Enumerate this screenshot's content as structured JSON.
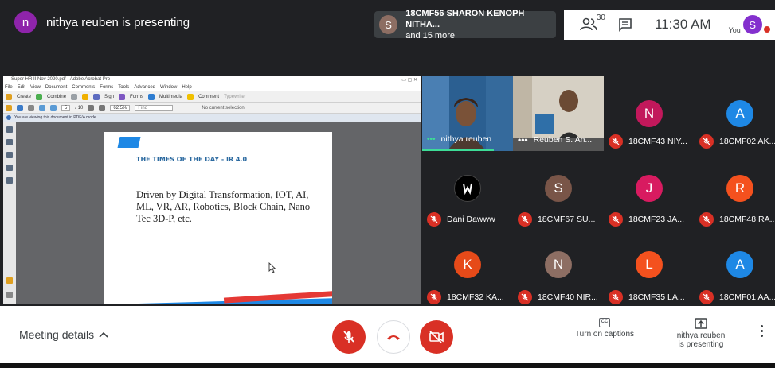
{
  "topbar": {
    "presenter_avatar": "n",
    "presenter_text": "nithya reuben is presenting",
    "participants_avatar": "S",
    "participants_name": "18CMF56 SHARON KENOPH NITHA...",
    "participants_more": "and 15 more",
    "people_icon": "people-icon",
    "people_count": "30",
    "chat_icon": "chat-icon",
    "time": "11:30 AM",
    "you_label": "You",
    "you_avatar": "S"
  },
  "acrobat": {
    "title": "Super HR II Nov 2020.pdf - Adobe Acrobat Pro",
    "menu": [
      "File",
      "Edit",
      "View",
      "Document",
      "Comments",
      "Forms",
      "Tools",
      "Advanced",
      "Window",
      "Help"
    ],
    "toolbar1": [
      "Create",
      "Combine",
      "Sign",
      "Forms",
      "Multimedia",
      "Comment",
      "Typewriter"
    ],
    "page_current": "5",
    "page_total": "10",
    "zoom": "62.5%",
    "find_placeholder": "Find",
    "no_selection": "No current selection",
    "info_bar": "You are viewing this document in PDF/A mode.",
    "slide_title": "THE TIMES OF THE DAY - IR 4.0",
    "slide_body": "Driven by Digital Transformation, IOT, AI, ML, VR, AR, Robotics, Block Chain, Nano Tec 3D-P, etc."
  },
  "tiles": [
    {
      "name": "nithya reuben",
      "type": "video"
    },
    {
      "name": "Reuben S. An...",
      "type": "video"
    },
    {
      "name": "18CMF43 NIY...",
      "avatar": "N",
      "color": "#c2185b"
    },
    {
      "name": "18CMF02 AK...",
      "avatar": "A",
      "color": "#1e88e5"
    },
    {
      "name": "Dani Dawww",
      "avatar": "",
      "color": "#000000"
    },
    {
      "name": "18CMF67 SU...",
      "avatar": "S",
      "color": "#795548"
    },
    {
      "name": "18CMF23 JA...",
      "avatar": "J",
      "color": "#d81b60"
    },
    {
      "name": "18CMF48 RA...",
      "avatar": "R",
      "color": "#f4511e"
    },
    {
      "name": "18CMF32 KA...",
      "avatar": "K",
      "color": "#e64a19"
    },
    {
      "name": "18CMF40 NIR...",
      "avatar": "N",
      "color": "#8d6e63"
    },
    {
      "name": "18CMF35 LA...",
      "avatar": "L",
      "color": "#f4511e"
    },
    {
      "name": "18CMF01 AA...",
      "avatar": "A",
      "color": "#1e88e5"
    }
  ],
  "bottombar": {
    "meeting_details": "Meeting details",
    "captions_label": "Turn on captions",
    "captions_icon": "CC",
    "present_label_1": "nithya reuben",
    "present_label_2": "is presenting"
  },
  "colors": {
    "mute_red": "#d93025",
    "meet_dark": "#202124",
    "presenter_purple": "#8e24aa",
    "you_purple": "#8430ce",
    "participant_brown": "#8d6e63"
  }
}
